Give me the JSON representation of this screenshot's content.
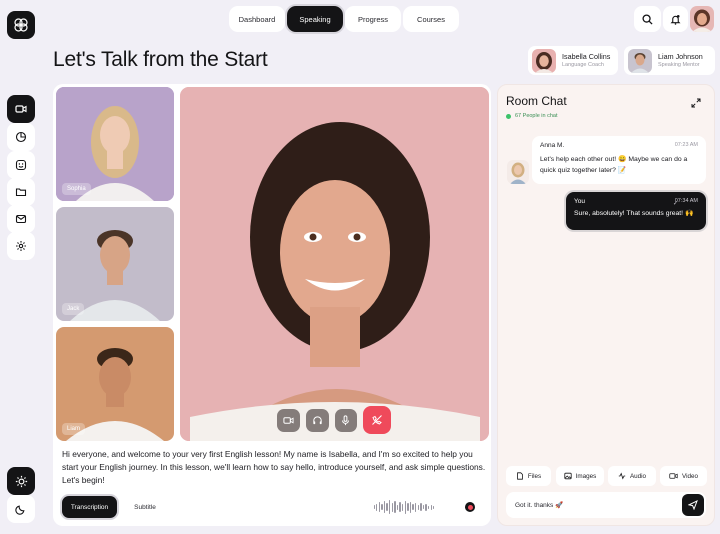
{
  "nav": {
    "items": [
      "Dashboard",
      "Speaking",
      "Progress",
      "Courses"
    ],
    "active": "Speaking"
  },
  "header": {
    "title": "Let's Talk from the Start"
  },
  "participants_top": [
    {
      "name": "Isabella Collins",
      "role": "Language Coach"
    },
    {
      "name": "Liam Johnson",
      "role": "Speaking Mentor"
    }
  ],
  "thumbnails": [
    "Sophia",
    "Jack",
    "Liam"
  ],
  "transcript": {
    "text": "Hi everyone, and welcome to your very first English lesson! My name is Isabella, and I'm so excited to help you start your English journey. In this lesson, we'll learn how to say hello, introduce yourself, and ask simple questions. Let's begin!",
    "tabs": [
      "Transcription",
      "Subtitle"
    ],
    "active_tab": "Transcription"
  },
  "chat": {
    "title": "Room Chat",
    "online": "67 People in chat",
    "messages": [
      {
        "author": "Anna M.",
        "time": "07:23 AM",
        "text": "Let's help each other out! 😄 Maybe we can do a quick quiz together later? 📝"
      },
      {
        "author": "You",
        "time": "07:34 AM",
        "text": "Sure, absolutely! That sounds great! 🙌"
      }
    ],
    "attachments": [
      "Files",
      "Images",
      "Audio",
      "Video"
    ],
    "input_value": "Got it. thanks 🚀"
  },
  "colors": {
    "accent_dark": "#141416",
    "end_call": "#ef4a5b",
    "online": "#3cc26a",
    "background": "#f1eff6"
  },
  "icons": {
    "sidebar": [
      "video-icon",
      "pie-chart-icon",
      "smile-icon",
      "folder-icon",
      "mail-icon",
      "settings-icon"
    ],
    "theme": [
      "sun-icon",
      "moon-icon"
    ]
  }
}
